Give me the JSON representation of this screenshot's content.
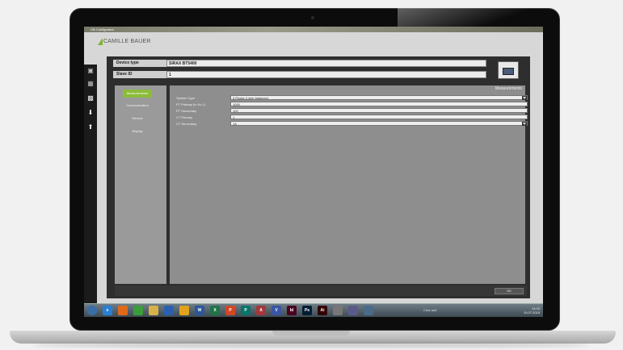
{
  "window": {
    "title": "CB-Configurator"
  },
  "brand": {
    "logo_text": "CAMILLE BAUER",
    "accent": "#8cbc3a"
  },
  "sidebar_icons": [
    {
      "name": "new-file-icon"
    },
    {
      "name": "open-folder-icon"
    },
    {
      "name": "save-icon"
    },
    {
      "name": "download-icon"
    },
    {
      "name": "upload-icon"
    }
  ],
  "device": {
    "type_label": "Device type",
    "type_value": "SIRAX BT5400",
    "slave_label": "Slave ID",
    "slave_value": "1"
  },
  "nav": {
    "items": [
      {
        "label": "Measurements",
        "active": true
      },
      {
        "label": "Communication",
        "active": false
      },
      {
        "label": "Service",
        "active": false
      },
      {
        "label": "Display",
        "active": false
      }
    ]
  },
  "section": {
    "title": "Measurements",
    "fields": [
      {
        "label": "System Type",
        "value": "3 Phase 4 wire balanced",
        "dropdown": true
      },
      {
        "label": "PT Primary (in Kv L)",
        "value": "1000",
        "dropdown": false
      },
      {
        "label": "PT Secondary",
        "value": "100",
        "dropdown": false
      },
      {
        "label": "CT Primary",
        "value": "1",
        "dropdown": false
      },
      {
        "label": "CT Secondary",
        "value": "1A",
        "dropdown": true
      }
    ]
  },
  "footer": {
    "ok_label": "OK"
  },
  "taskbar": {
    "apps": [
      {
        "name": "start-icon",
        "glyph": "",
        "color": "#3a6ea5"
      },
      {
        "name": "ie-icon",
        "glyph": "e",
        "color": "#2a7fd4"
      },
      {
        "name": "firefox-icon",
        "glyph": "",
        "color": "#e06a1a"
      },
      {
        "name": "chrome-icon",
        "glyph": "",
        "color": "#3c9d3c"
      },
      {
        "name": "explorer-icon",
        "glyph": "",
        "color": "#d8b04a"
      },
      {
        "name": "media-icon",
        "glyph": "",
        "color": "#2b60b0"
      },
      {
        "name": "outlook-icon",
        "glyph": "",
        "color": "#e2a21b"
      },
      {
        "name": "word-icon",
        "glyph": "W",
        "color": "#2b579a"
      },
      {
        "name": "excel-icon",
        "glyph": "X",
        "color": "#217346"
      },
      {
        "name": "powerpoint-icon",
        "glyph": "P",
        "color": "#d24726"
      },
      {
        "name": "publisher-icon",
        "glyph": "P",
        "color": "#077568"
      },
      {
        "name": "access-icon",
        "glyph": "A",
        "color": "#a4373a"
      },
      {
        "name": "visio-icon",
        "glyph": "V",
        "color": "#3955a3"
      },
      {
        "name": "indesign-icon",
        "glyph": "Id",
        "color": "#49021f"
      },
      {
        "name": "photoshop-icon",
        "glyph": "Ps",
        "color": "#001d34"
      },
      {
        "name": "illustrator-icon",
        "glyph": "Ai",
        "color": "#330000"
      },
      {
        "name": "app-icon-1",
        "glyph": "",
        "color": "#777777"
      },
      {
        "name": "app-icon-2",
        "glyph": "",
        "color": "#5a5a8a"
      },
      {
        "name": "app-icon-3",
        "glyph": "",
        "color": "#4a6a8a"
      }
    ],
    "tray_text": "Click add",
    "time": "14:03",
    "date": "10.07.2015"
  }
}
